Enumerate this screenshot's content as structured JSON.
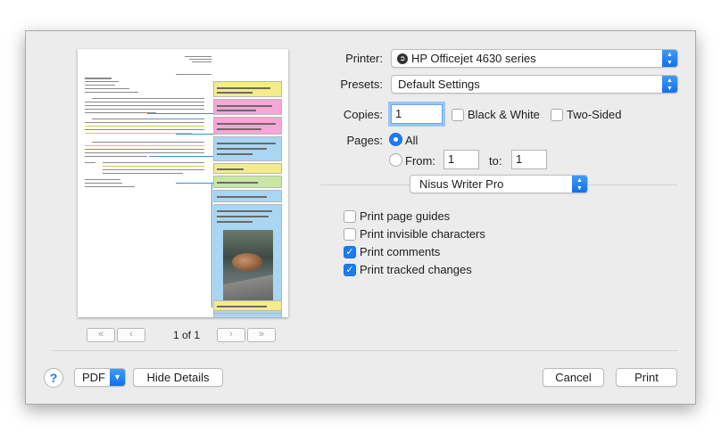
{
  "preview": {
    "page_indicator": "1 of 1",
    "first_page_glyph": "«",
    "prev_page_glyph": "‹",
    "next_page_glyph": "›",
    "last_page_glyph": "»",
    "comment_colors": [
      "#f4ec8a",
      "#f7a6d6",
      "#f7a6d6",
      "#a9d6f2",
      "#f4ec8a",
      "#c9e7a4",
      "#a9d6f2",
      "#f4ec8a",
      "#a9d6f2"
    ]
  },
  "printer": {
    "label": "Printer:",
    "value": "HP Officejet 4630 series"
  },
  "presets": {
    "label": "Presets:",
    "value": "Default Settings"
  },
  "copies": {
    "label": "Copies:",
    "value": "1",
    "black_white": "Black & White",
    "two_sided": "Two-Sided"
  },
  "pages": {
    "label": "Pages:",
    "all": "All",
    "from": "From:",
    "from_value": "1",
    "to": "to:",
    "to_value": "1"
  },
  "app_section": {
    "value": "Nisus Writer Pro"
  },
  "options": [
    {
      "label": "Print page guides",
      "checked": false
    },
    {
      "label": "Print invisible characters",
      "checked": false
    },
    {
      "label": "Print comments",
      "checked": true
    },
    {
      "label": "Print tracked changes",
      "checked": true
    }
  ],
  "footer": {
    "help": "?",
    "pdf": "PDF",
    "hide_details": "Hide Details",
    "cancel": "Cancel",
    "print": "Print"
  },
  "colors": {
    "accent": "#1b7cf2",
    "dialog_bg": "#ececec"
  }
}
